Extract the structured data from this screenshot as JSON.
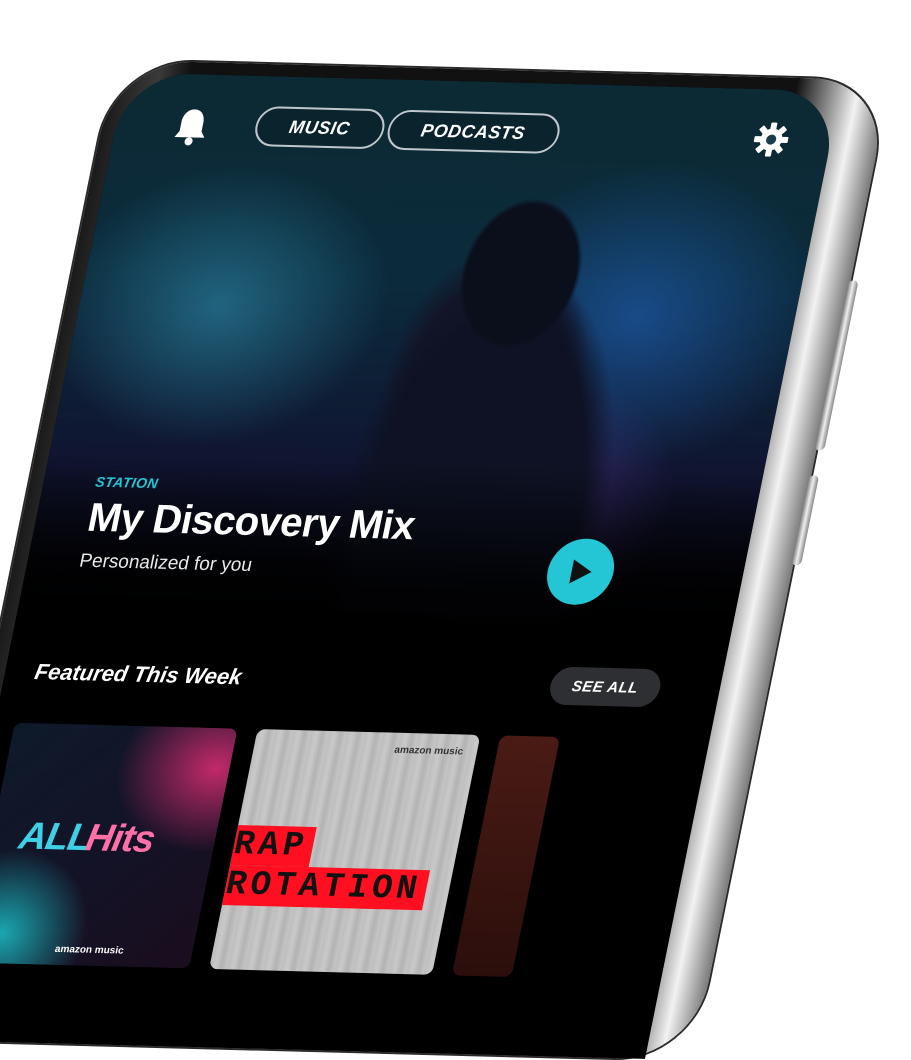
{
  "topbar": {
    "tabs": [
      {
        "label": "MUSIC"
      },
      {
        "label": "PODCASTS"
      }
    ],
    "left_icon": "bell-icon",
    "right_icon": "gear-icon"
  },
  "hero": {
    "eyebrow": "STATION",
    "title": "My Discovery Mix",
    "subtitle": "Personalized for you",
    "play_icon": "play-icon",
    "accent_color": "#24c6d6"
  },
  "featured": {
    "title": "Featured This Week",
    "see_all_label": "SEE ALL",
    "cards": [
      {
        "title_part1": "ALL",
        "title_part2": "Hits",
        "logo": "amazon music"
      },
      {
        "title_line1": "RAP",
        "title_line2": "ROTATION",
        "logo": "amazon music"
      },
      {}
    ]
  }
}
